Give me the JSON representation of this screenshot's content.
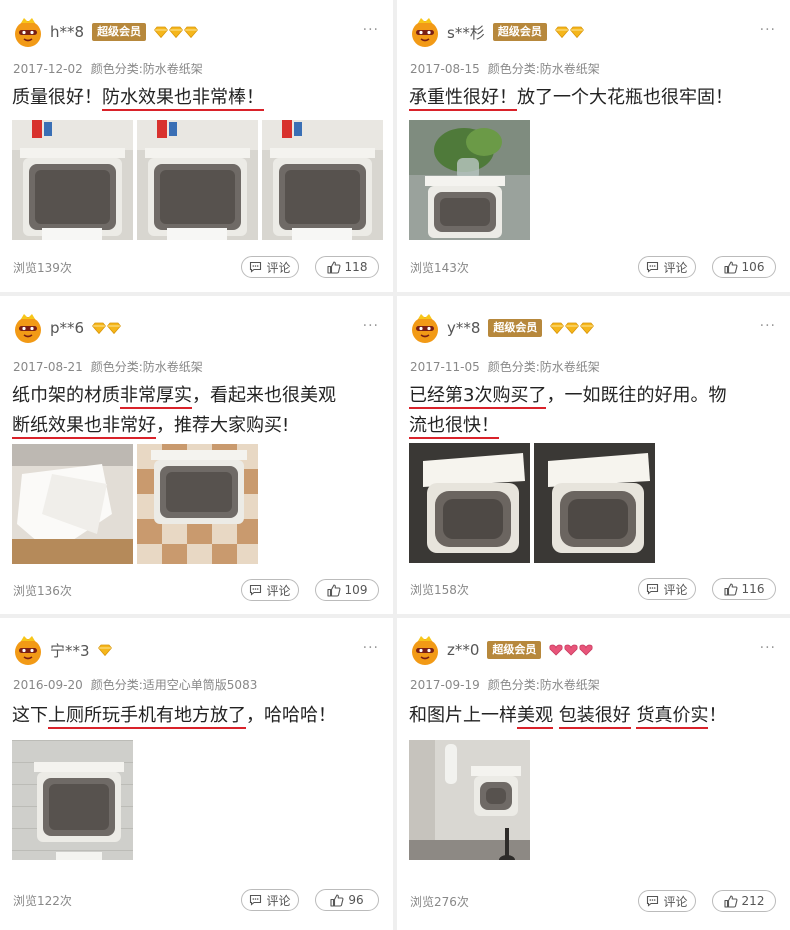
{
  "labels": {
    "comment": "评论",
    "more": "···",
    "vip": "超级会员"
  },
  "reviews": [
    {
      "user": "h**8",
      "vip": true,
      "gems": [
        "gold",
        "gold",
        "gold"
      ],
      "date": "2017-12-02",
      "category": "颜色分类:防水卷纸架",
      "text_lines": [
        [
          {
            "t": "质量很好！"
          },
          {
            "t": "防水效果也非常棒！",
            "u": true
          }
        ]
      ],
      "photos": [
        "holder",
        "holder",
        "holder"
      ],
      "views": "浏览139次",
      "likes": "118"
    },
    {
      "user": "s**杉",
      "vip": true,
      "gems": [
        "gold",
        "gold"
      ],
      "date": "2017-08-15",
      "category": "颜色分类:防水卷纸架",
      "text_lines": [
        [
          {
            "t": "承重性很好！",
            "u": true
          },
          {
            "t": "放了一个大花瓶也很牢固！"
          }
        ]
      ],
      "photos": [
        "plant"
      ],
      "views": "浏览143次",
      "likes": "106"
    },
    {
      "user": "p**6",
      "vip": false,
      "gems": [
        "gold",
        "gold"
      ],
      "date": "2017-08-21",
      "category": "颜色分类:防水卷纸架",
      "text_lines": [
        [
          {
            "t": "纸巾架的材质"
          },
          {
            "t": "非常厚实",
            "u": true
          },
          {
            "t": "，看起来也很美观"
          }
        ],
        [
          {
            "t": "断纸效果也非常好",
            "u": true
          },
          {
            "t": "，推荐大家购买!"
          }
        ]
      ],
      "photos": [
        "paper",
        "tiles"
      ],
      "views": "浏览136次",
      "likes": "109"
    },
    {
      "user": "y**8",
      "vip": true,
      "gems": [
        "gold",
        "gold",
        "gold"
      ],
      "date": "2017-11-05",
      "category": "颜色分类:防水卷纸架",
      "text_lines": [
        [
          {
            "t": "已经第3次购买了",
            "u": true
          },
          {
            "t": "，一如既往的好用。物"
          }
        ],
        [
          {
            "t": "流也很快！",
            "u": true
          }
        ]
      ],
      "photos": [
        "dark",
        "dark"
      ],
      "views": "浏览158次",
      "likes": "116"
    },
    {
      "user": "宁**3",
      "vip": false,
      "gems": [
        "gold"
      ],
      "date": "2016-09-20",
      "category": "颜色分类:适用空心单筒版5083",
      "text_lines": [
        [
          {
            "t": "这下"
          },
          {
            "t": "上厕所玩手机有地方放了",
            "u": true
          },
          {
            "t": "，哈哈哈！"
          }
        ]
      ],
      "photos": [
        "wall"
      ],
      "views": "浏览122次",
      "likes": "96"
    },
    {
      "user": "z**0",
      "vip": true,
      "gems": [
        "pink",
        "pink",
        "pink"
      ],
      "date": "2017-09-19",
      "category": "颜色分类:防水卷纸架",
      "text_lines": [
        [
          {
            "t": "和图片上一样"
          },
          {
            "t": "美观",
            "u": true
          },
          {
            "t": " "
          },
          {
            "t": "包装很好",
            "u": true
          },
          {
            "t": " "
          },
          {
            "t": "货真价实",
            "u": true
          },
          {
            "t": "！"
          }
        ]
      ],
      "photos": [
        "bathroom"
      ],
      "views": "浏览276次",
      "likes": "212"
    }
  ]
}
